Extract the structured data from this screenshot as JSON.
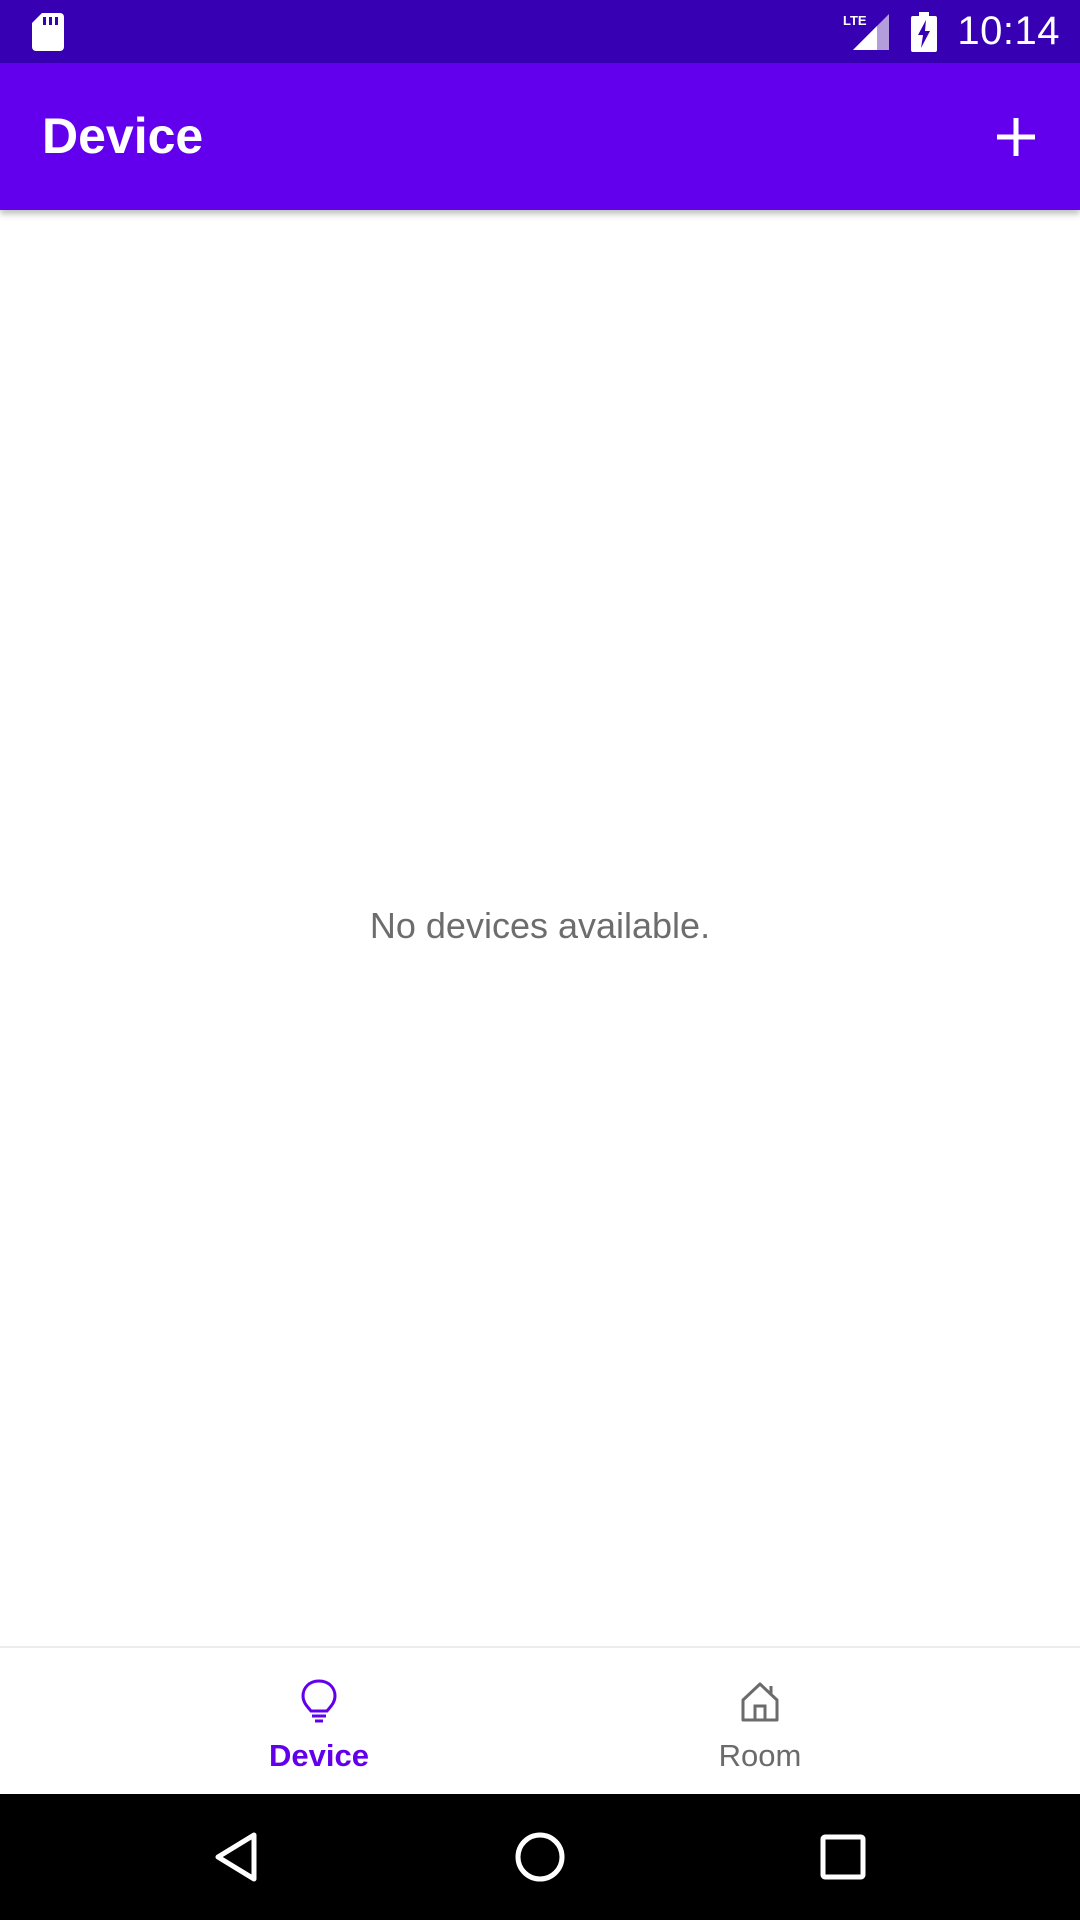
{
  "status_bar": {
    "time": "10:14",
    "network": "LTE",
    "icons": [
      "sd-card-icon",
      "lte-signal-icon",
      "battery-charging-icon"
    ]
  },
  "app_bar": {
    "title": "Device",
    "action_icon": "add-icon"
  },
  "content": {
    "empty_message": "No devices available."
  },
  "bottom_nav": {
    "items": [
      {
        "label": "Device",
        "icon": "lightbulb-icon",
        "selected": true
      },
      {
        "label": "Room",
        "icon": "house-icon",
        "selected": false
      }
    ]
  },
  "system_nav": {
    "icons": [
      "back-icon",
      "home-icon",
      "recents-icon"
    ]
  },
  "colors": {
    "status_bar": "#3700b3",
    "primary": "#6200ee",
    "inactive": "#6b6b6b",
    "empty_text": "#6d6d6d"
  }
}
